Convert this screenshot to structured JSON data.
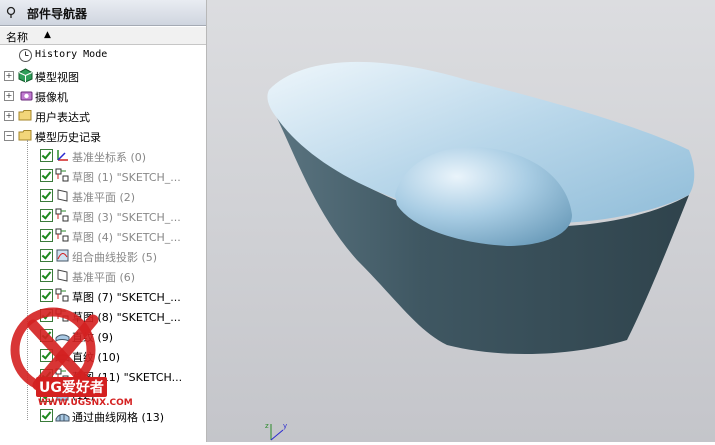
{
  "navigator": {
    "title": "部件导航器",
    "column_header": "名称",
    "sort_indicator": "▲",
    "items": [
      {
        "label": "History Mode",
        "icon": "clock-icon",
        "expand": null,
        "checked": null,
        "gray": false
      },
      {
        "label": "模型视图",
        "icon": "model-view-icon",
        "expand": "+",
        "checked": null,
        "gray": false
      },
      {
        "label": "摄像机",
        "icon": "camera-icon",
        "expand": "+",
        "checked": null,
        "gray": false
      },
      {
        "label": "用户表达式",
        "icon": "folder-icon",
        "expand": "+",
        "checked": null,
        "gray": false
      },
      {
        "label": "模型历史记录",
        "icon": "folder-icon",
        "expand": "-",
        "checked": null,
        "gray": false
      },
      {
        "label": "基准坐标系 (0)",
        "icon": "datum-csys-icon",
        "checked": true,
        "gray": true
      },
      {
        "label": "草图 (1) \"SKETCH_...",
        "icon": "sketch-icon",
        "checked": true,
        "gray": true
      },
      {
        "label": "基准平面 (2)",
        "icon": "datum-plane-icon",
        "checked": true,
        "gray": true
      },
      {
        "label": "草图 (3) \"SKETCH_...",
        "icon": "sketch-icon",
        "checked": true,
        "gray": true
      },
      {
        "label": "草图 (4) \"SKETCH_...",
        "icon": "sketch-icon",
        "checked": true,
        "gray": true
      },
      {
        "label": "组合曲线投影 (5)",
        "icon": "projected-curve-icon",
        "checked": true,
        "gray": true
      },
      {
        "label": "基准平面 (6)",
        "icon": "datum-plane-icon",
        "checked": true,
        "gray": true
      },
      {
        "label": "草图 (7) \"SKETCH_...",
        "icon": "sketch-icon",
        "checked": true,
        "gray": false
      },
      {
        "label": "草图 (8) \"SKETCH_...",
        "icon": "sketch-icon",
        "checked": true,
        "gray": false
      },
      {
        "label": "直纹 (9)",
        "icon": "ruled-surface-icon",
        "checked": true,
        "gray": false
      },
      {
        "label": "直纹 (10)",
        "icon": "ruled-surface-icon",
        "checked": true,
        "gray": false
      },
      {
        "label": "草图 (11) \"SKETCH...",
        "icon": "sketch-icon",
        "checked": true,
        "gray": false
      },
      {
        "label": "(12)",
        "icon": "feature-icon",
        "checked": true,
        "gray": false
      },
      {
        "label": "通过曲线网格 (13)",
        "icon": "through-curve-mesh-icon",
        "checked": true,
        "gray": false
      }
    ]
  },
  "watermark": {
    "brand": "UG爱好者",
    "url": "WWW.UGSNX.COM"
  },
  "colors": {
    "model_top": "#b9d7ea",
    "model_side": "#3f5762",
    "watermark_red": "#d42020"
  }
}
